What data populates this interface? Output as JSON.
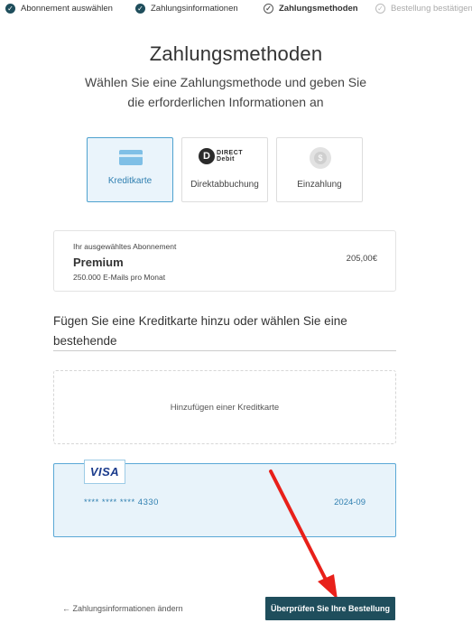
{
  "stepper": {
    "steps": [
      {
        "label": "Abonnement auswählen",
        "state": "done"
      },
      {
        "label": "Zahlungsinformationen",
        "state": "done"
      },
      {
        "label": "Zahlungsmethoden",
        "state": "current"
      },
      {
        "label": "Bestellung bestätigen",
        "state": "todo"
      }
    ]
  },
  "header": {
    "title": "Zahlungsmethoden",
    "subtitle": "Wählen Sie eine Zahlungsmethode und geben Sie die erforderlichen Informationen an"
  },
  "payment_methods": [
    {
      "label": "Kreditkarte",
      "icon": "credit-card-icon",
      "selected": true
    },
    {
      "label": "Direktabbuchung",
      "icon": "direct-debit-icon",
      "icon_text_1": "DIRECT",
      "icon_text_2": "Debit",
      "selected": false
    },
    {
      "label": "Einzahlung",
      "icon": "coin-icon",
      "icon_text": "$",
      "selected": false
    }
  ],
  "subscription": {
    "pre_label": "Ihr ausgewähltes Abonnement",
    "plan": "Premium",
    "description": "250.000 E-Mails pro Monat",
    "price": "205,00€"
  },
  "card_section": {
    "heading": "Fügen Sie eine Kreditkarte hinzu oder wählen Sie eine bestehende",
    "add_card_label": "Hinzufügen einer Kreditkarte",
    "saved_card": {
      "brand": "VISA",
      "number": "**** **** **** 4330",
      "expiry": "2024-09"
    }
  },
  "footer": {
    "back_label": "← Zahlungsinformationen ändern",
    "review_label": "Überprüfen Sie Ihre Bestellung"
  },
  "colors": {
    "primary": "#1f4e5c",
    "accent_blue": "#4ea2cf",
    "selected_bg": "#eaf4fb",
    "annotation_arrow": "#e8201a"
  }
}
